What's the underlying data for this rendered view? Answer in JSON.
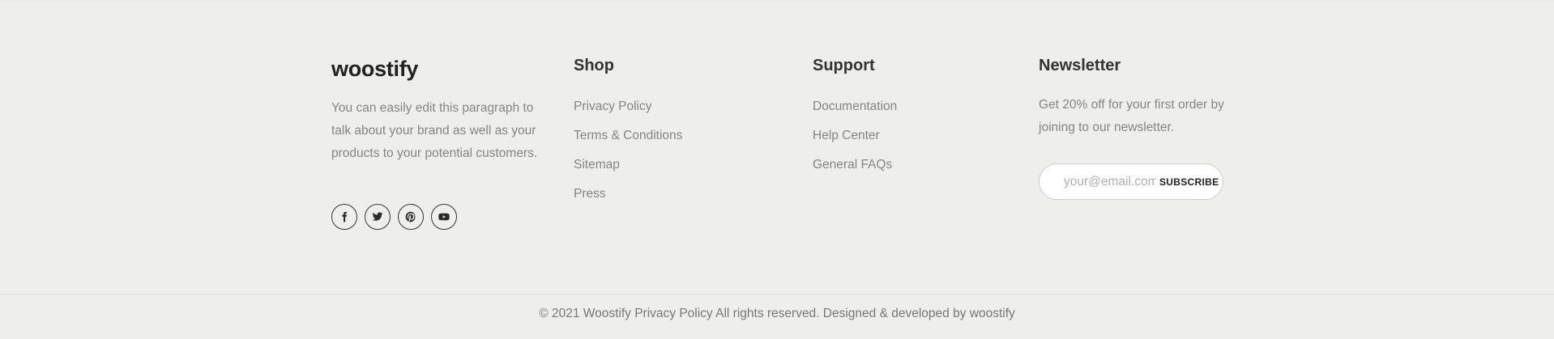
{
  "brand": {
    "logo": "woostify",
    "description": "You can easily edit this paragraph to talk about your brand as well as your products to your potential customers.",
    "socials": [
      {
        "name": "facebook-icon"
      },
      {
        "name": "twitter-icon"
      },
      {
        "name": "pinterest-icon"
      },
      {
        "name": "youtube-icon"
      }
    ]
  },
  "shop": {
    "title": "Shop",
    "links": [
      "Privacy Policy",
      "Terms & Conditions",
      "Sitemap",
      "Press"
    ]
  },
  "support": {
    "title": "Support",
    "links": [
      "Documentation",
      "Help Center",
      "General FAQs"
    ]
  },
  "newsletter": {
    "title": "Newsletter",
    "text": "Get 20% off for your first order by joining to our newsletter.",
    "email_placeholder": "your@email.com",
    "button_label": "SUBSCRIBE"
  },
  "copyright": "© 2021 Woostify Privacy Policy All rights reserved. Designed & developed by woostify"
}
